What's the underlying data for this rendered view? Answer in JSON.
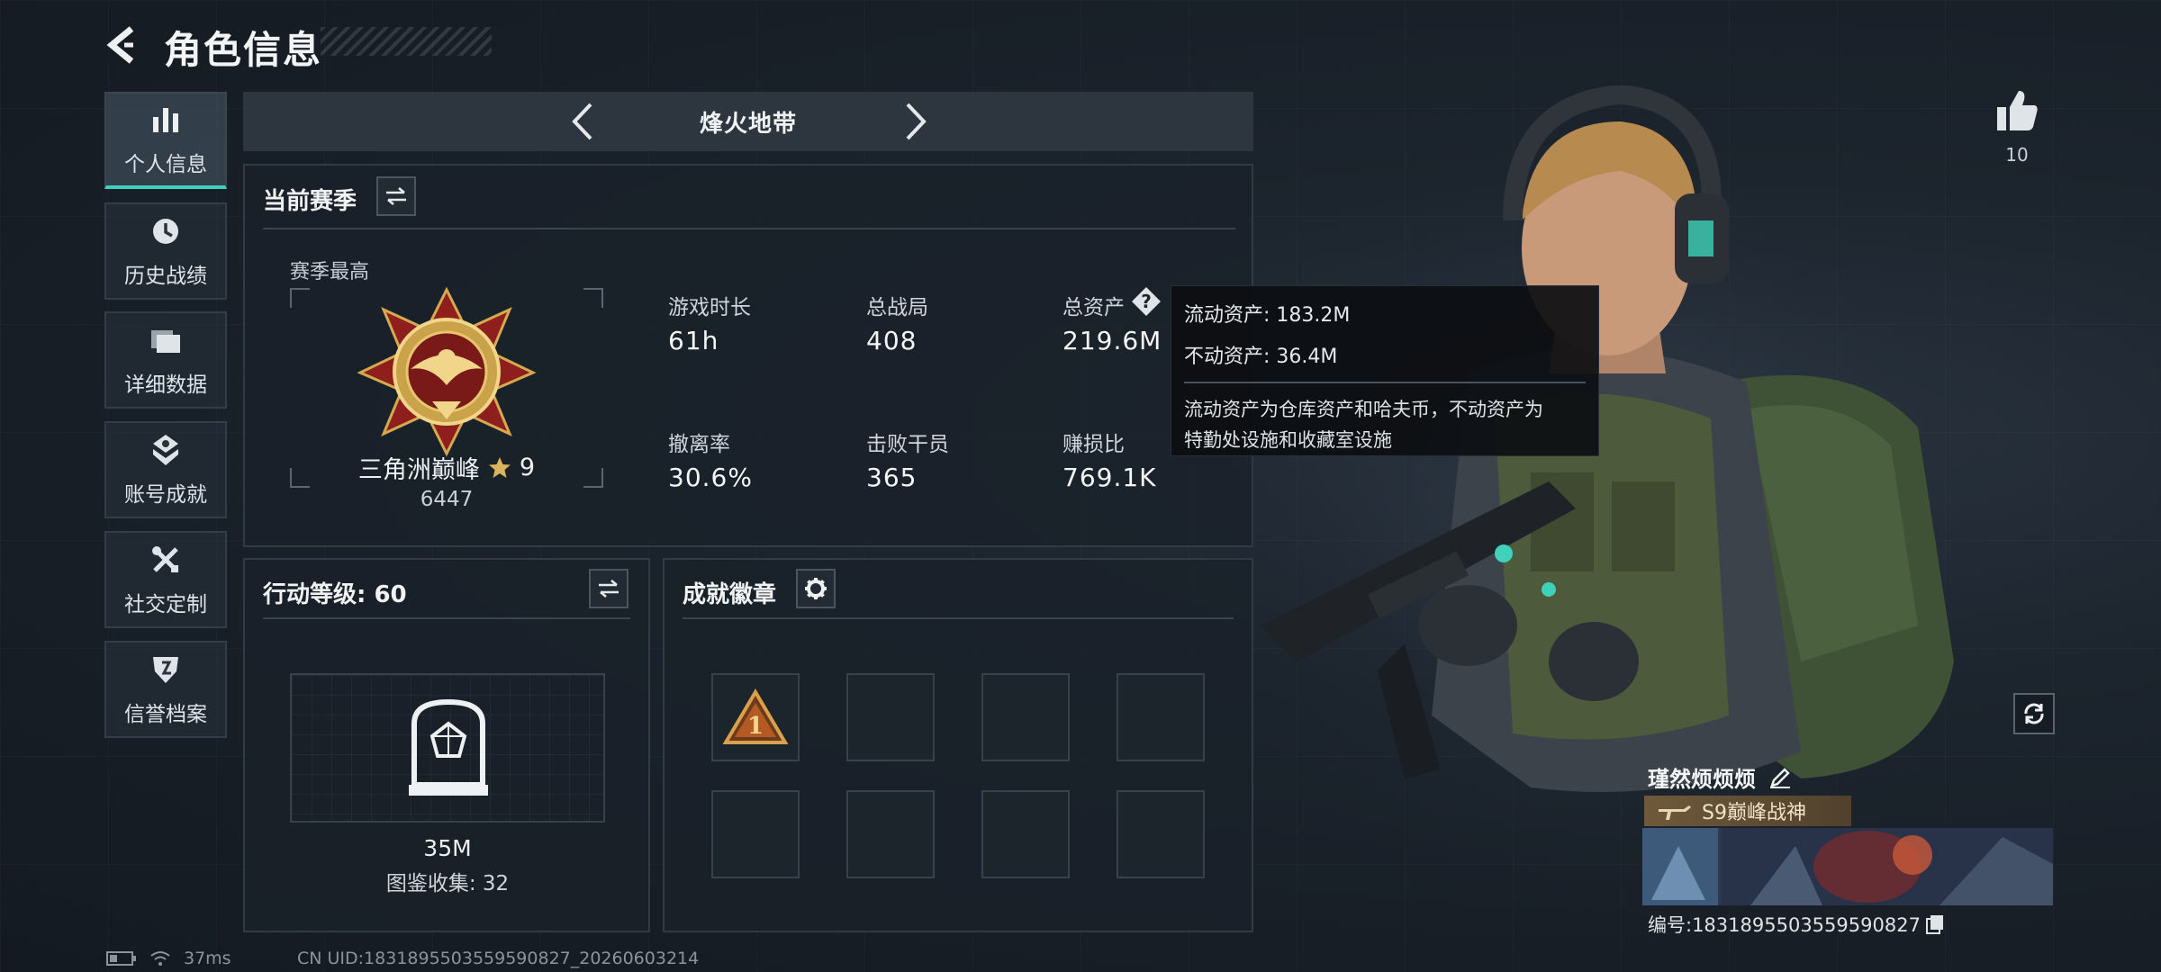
{
  "header": {
    "title": "角色信息"
  },
  "sidebar": {
    "items": [
      {
        "label": "个人信息",
        "icon": "bar-chart-icon",
        "active": true
      },
      {
        "label": "历史战绩",
        "icon": "clock-icon"
      },
      {
        "label": "详细数据",
        "icon": "folder-icon"
      },
      {
        "label": "账号成就",
        "icon": "achievement-icon"
      },
      {
        "label": "社交定制",
        "icon": "tools-icon"
      },
      {
        "label": "信誉档案",
        "icon": "shield-icon"
      }
    ]
  },
  "mode": {
    "label": "烽火地带"
  },
  "season": {
    "title": "当前赛季",
    "best_label": "赛季最高",
    "rank_name": "三角洲巅峰",
    "rank_star": "9",
    "rank_score": "6447",
    "stats": [
      {
        "label": "游戏时长",
        "value": "61h"
      },
      {
        "label": "总战局",
        "value": "408"
      },
      {
        "label": "总资产",
        "value": "219.6M"
      },
      {
        "label": "撤离率",
        "value": "30.6%"
      },
      {
        "label": "击败干员",
        "value": "365"
      },
      {
        "label": "赚损比",
        "value": "769.1K"
      }
    ]
  },
  "tooltip": {
    "liquid": "流动资产: 183.2M",
    "fixed": "不动资产: 36.4M",
    "note_line1": "流动资产为仓库资产和哈夫币，不动资产为",
    "note_line2": "特勤处设施和收藏室设施"
  },
  "action_level": {
    "title": "行动等级: 60",
    "value": "35M",
    "collection": "图鉴收集: 32"
  },
  "achievements": {
    "title": "成就徽章",
    "first_badge": "1"
  },
  "likes": {
    "count": "10"
  },
  "player": {
    "name": "瑾然烦烦烦",
    "title_tag": "S9巅峰战神",
    "id": "编号:1831895503559590827"
  },
  "footer": {
    "ping": "37ms",
    "uid": "CN UID:1831895503559590827_20260603214"
  },
  "colors": {
    "accent": "#3fd1b9",
    "panel_bg": "#1a2129",
    "tooltip_bg": "#0c0e11",
    "gold": "#c9a24a"
  }
}
